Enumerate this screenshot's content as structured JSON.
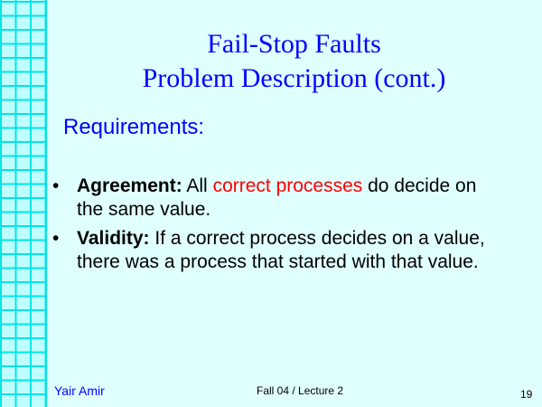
{
  "title": {
    "line1": "Fail-Stop Faults",
    "line2": "Problem Description (cont.)"
  },
  "subtitle": "Requirements:",
  "bullets": [
    {
      "term": "Agreement:",
      "pre": " All ",
      "highlight": "correct processes",
      "post": " do decide on the same value."
    },
    {
      "term": "Validity:",
      "text": " If a correct process decides on a value, there was a process that started with that value."
    }
  ],
  "footer": {
    "author": "Yair Amir",
    "course": "Fall 04 / Lecture 2",
    "page": "19"
  },
  "colors": {
    "title": "#0000ff",
    "highlight": "#ff0000",
    "background": "#e0ffff",
    "grid": "#00e5e5"
  }
}
